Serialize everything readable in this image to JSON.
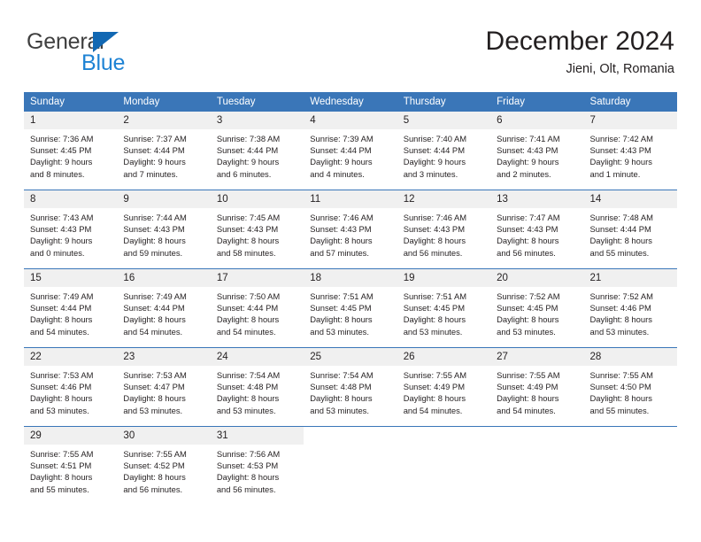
{
  "logo": {
    "word_one": "General",
    "word_two": "Blue",
    "triangle_icon": "triangle-icon",
    "brand_dark": "#3f3f3f",
    "brand_blue": "#1e83d4",
    "triangle_blue": "#1268b3"
  },
  "header": {
    "month_title": "December 2024",
    "location": "Jieni, Olt, Romania"
  },
  "theme": {
    "header_blue": "#3a76b8",
    "daynum_band": "#f0f0f0",
    "text": "#231f20",
    "divider": "#3a76b8"
  },
  "calendar": {
    "weekday_headers": [
      "Sunday",
      "Monday",
      "Tuesday",
      "Wednesday",
      "Thursday",
      "Friday",
      "Saturday"
    ],
    "weeks": [
      [
        {
          "day": "1",
          "sunrise": "Sunrise: 7:36 AM",
          "sunset": "Sunset: 4:45 PM",
          "daylight_line1": "Daylight: 9 hours",
          "daylight_line2": "and 8 minutes."
        },
        {
          "day": "2",
          "sunrise": "Sunrise: 7:37 AM",
          "sunset": "Sunset: 4:44 PM",
          "daylight_line1": "Daylight: 9 hours",
          "daylight_line2": "and 7 minutes."
        },
        {
          "day": "3",
          "sunrise": "Sunrise: 7:38 AM",
          "sunset": "Sunset: 4:44 PM",
          "daylight_line1": "Daylight: 9 hours",
          "daylight_line2": "and 6 minutes."
        },
        {
          "day": "4",
          "sunrise": "Sunrise: 7:39 AM",
          "sunset": "Sunset: 4:44 PM",
          "daylight_line1": "Daylight: 9 hours",
          "daylight_line2": "and 4 minutes."
        },
        {
          "day": "5",
          "sunrise": "Sunrise: 7:40 AM",
          "sunset": "Sunset: 4:44 PM",
          "daylight_line1": "Daylight: 9 hours",
          "daylight_line2": "and 3 minutes."
        },
        {
          "day": "6",
          "sunrise": "Sunrise: 7:41 AM",
          "sunset": "Sunset: 4:43 PM",
          "daylight_line1": "Daylight: 9 hours",
          "daylight_line2": "and 2 minutes."
        },
        {
          "day": "7",
          "sunrise": "Sunrise: 7:42 AM",
          "sunset": "Sunset: 4:43 PM",
          "daylight_line1": "Daylight: 9 hours",
          "daylight_line2": "and 1 minute."
        }
      ],
      [
        {
          "day": "8",
          "sunrise": "Sunrise: 7:43 AM",
          "sunset": "Sunset: 4:43 PM",
          "daylight_line1": "Daylight: 9 hours",
          "daylight_line2": "and 0 minutes."
        },
        {
          "day": "9",
          "sunrise": "Sunrise: 7:44 AM",
          "sunset": "Sunset: 4:43 PM",
          "daylight_line1": "Daylight: 8 hours",
          "daylight_line2": "and 59 minutes."
        },
        {
          "day": "10",
          "sunrise": "Sunrise: 7:45 AM",
          "sunset": "Sunset: 4:43 PM",
          "daylight_line1": "Daylight: 8 hours",
          "daylight_line2": "and 58 minutes."
        },
        {
          "day": "11",
          "sunrise": "Sunrise: 7:46 AM",
          "sunset": "Sunset: 4:43 PM",
          "daylight_line1": "Daylight: 8 hours",
          "daylight_line2": "and 57 minutes."
        },
        {
          "day": "12",
          "sunrise": "Sunrise: 7:46 AM",
          "sunset": "Sunset: 4:43 PM",
          "daylight_line1": "Daylight: 8 hours",
          "daylight_line2": "and 56 minutes."
        },
        {
          "day": "13",
          "sunrise": "Sunrise: 7:47 AM",
          "sunset": "Sunset: 4:43 PM",
          "daylight_line1": "Daylight: 8 hours",
          "daylight_line2": "and 56 minutes."
        },
        {
          "day": "14",
          "sunrise": "Sunrise: 7:48 AM",
          "sunset": "Sunset: 4:44 PM",
          "daylight_line1": "Daylight: 8 hours",
          "daylight_line2": "and 55 minutes."
        }
      ],
      [
        {
          "day": "15",
          "sunrise": "Sunrise: 7:49 AM",
          "sunset": "Sunset: 4:44 PM",
          "daylight_line1": "Daylight: 8 hours",
          "daylight_line2": "and 54 minutes."
        },
        {
          "day": "16",
          "sunrise": "Sunrise: 7:49 AM",
          "sunset": "Sunset: 4:44 PM",
          "daylight_line1": "Daylight: 8 hours",
          "daylight_line2": "and 54 minutes."
        },
        {
          "day": "17",
          "sunrise": "Sunrise: 7:50 AM",
          "sunset": "Sunset: 4:44 PM",
          "daylight_line1": "Daylight: 8 hours",
          "daylight_line2": "and 54 minutes."
        },
        {
          "day": "18",
          "sunrise": "Sunrise: 7:51 AM",
          "sunset": "Sunset: 4:45 PM",
          "daylight_line1": "Daylight: 8 hours",
          "daylight_line2": "and 53 minutes."
        },
        {
          "day": "19",
          "sunrise": "Sunrise: 7:51 AM",
          "sunset": "Sunset: 4:45 PM",
          "daylight_line1": "Daylight: 8 hours",
          "daylight_line2": "and 53 minutes."
        },
        {
          "day": "20",
          "sunrise": "Sunrise: 7:52 AM",
          "sunset": "Sunset: 4:45 PM",
          "daylight_line1": "Daylight: 8 hours",
          "daylight_line2": "and 53 minutes."
        },
        {
          "day": "21",
          "sunrise": "Sunrise: 7:52 AM",
          "sunset": "Sunset: 4:46 PM",
          "daylight_line1": "Daylight: 8 hours",
          "daylight_line2": "and 53 minutes."
        }
      ],
      [
        {
          "day": "22",
          "sunrise": "Sunrise: 7:53 AM",
          "sunset": "Sunset: 4:46 PM",
          "daylight_line1": "Daylight: 8 hours",
          "daylight_line2": "and 53 minutes."
        },
        {
          "day": "23",
          "sunrise": "Sunrise: 7:53 AM",
          "sunset": "Sunset: 4:47 PM",
          "daylight_line1": "Daylight: 8 hours",
          "daylight_line2": "and 53 minutes."
        },
        {
          "day": "24",
          "sunrise": "Sunrise: 7:54 AM",
          "sunset": "Sunset: 4:48 PM",
          "daylight_line1": "Daylight: 8 hours",
          "daylight_line2": "and 53 minutes."
        },
        {
          "day": "25",
          "sunrise": "Sunrise: 7:54 AM",
          "sunset": "Sunset: 4:48 PM",
          "daylight_line1": "Daylight: 8 hours",
          "daylight_line2": "and 53 minutes."
        },
        {
          "day": "26",
          "sunrise": "Sunrise: 7:55 AM",
          "sunset": "Sunset: 4:49 PM",
          "daylight_line1": "Daylight: 8 hours",
          "daylight_line2": "and 54 minutes."
        },
        {
          "day": "27",
          "sunrise": "Sunrise: 7:55 AM",
          "sunset": "Sunset: 4:49 PM",
          "daylight_line1": "Daylight: 8 hours",
          "daylight_line2": "and 54 minutes."
        },
        {
          "day": "28",
          "sunrise": "Sunrise: 7:55 AM",
          "sunset": "Sunset: 4:50 PM",
          "daylight_line1": "Daylight: 8 hours",
          "daylight_line2": "and 55 minutes."
        }
      ],
      [
        {
          "day": "29",
          "sunrise": "Sunrise: 7:55 AM",
          "sunset": "Sunset: 4:51 PM",
          "daylight_line1": "Daylight: 8 hours",
          "daylight_line2": "and 55 minutes."
        },
        {
          "day": "30",
          "sunrise": "Sunrise: 7:55 AM",
          "sunset": "Sunset: 4:52 PM",
          "daylight_line1": "Daylight: 8 hours",
          "daylight_line2": "and 56 minutes."
        },
        {
          "day": "31",
          "sunrise": "Sunrise: 7:56 AM",
          "sunset": "Sunset: 4:53 PM",
          "daylight_line1": "Daylight: 8 hours",
          "daylight_line2": "and 56 minutes."
        },
        {
          "day": "",
          "sunrise": "",
          "sunset": "",
          "daylight_line1": "",
          "daylight_line2": ""
        },
        {
          "day": "",
          "sunrise": "",
          "sunset": "",
          "daylight_line1": "",
          "daylight_line2": ""
        },
        {
          "day": "",
          "sunrise": "",
          "sunset": "",
          "daylight_line1": "",
          "daylight_line2": ""
        },
        {
          "day": "",
          "sunrise": "",
          "sunset": "",
          "daylight_line1": "",
          "daylight_line2": ""
        }
      ]
    ]
  }
}
